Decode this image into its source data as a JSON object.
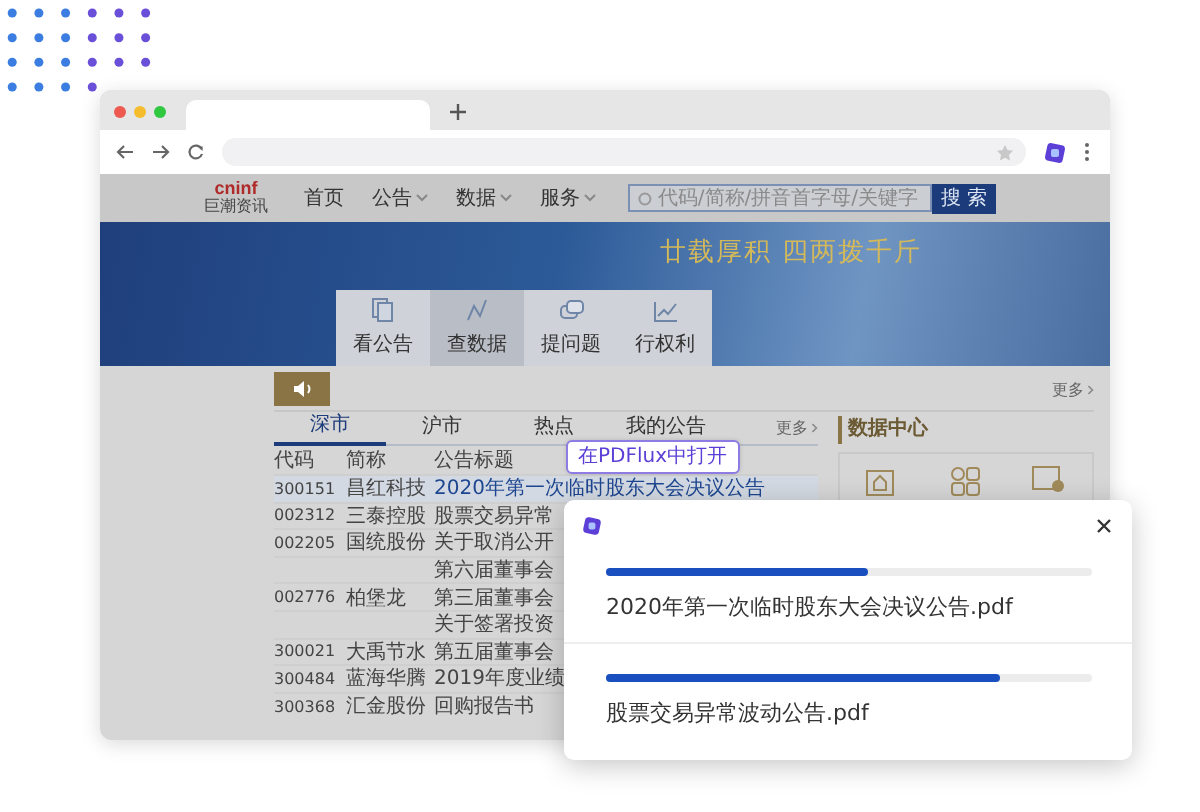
{
  "site_nav": {
    "logo": {
      "wordmark": "cninf",
      "subtitle": "巨潮资讯"
    },
    "items": [
      {
        "label": "首页",
        "has_menu": false
      },
      {
        "label": "公告",
        "has_menu": true
      },
      {
        "label": "数据",
        "has_menu": true
      },
      {
        "label": "服务",
        "has_menu": true
      }
    ],
    "search": {
      "placeholder": "代码/简称/拼音首字母/关键字",
      "button": "搜 索"
    }
  },
  "banner": {
    "slogan": "廿载厚积 四两拨千斤",
    "tiles": [
      {
        "label": "看公告",
        "selected": false
      },
      {
        "label": "查数据",
        "selected": true
      },
      {
        "label": "提问题",
        "selected": false
      },
      {
        "label": "行权利",
        "selected": false
      }
    ]
  },
  "top_more": "更多",
  "announcements": {
    "tabs": [
      {
        "label": "深市",
        "selected": true
      },
      {
        "label": "沪市",
        "selected": false
      },
      {
        "label": "热点",
        "selected": false
      },
      {
        "label": "我的公告",
        "selected": false
      }
    ],
    "more": "更多",
    "columns": [
      "代码",
      "简称",
      "公告标题"
    ],
    "rows": [
      {
        "code": "300151",
        "name": "昌红科技",
        "title": "2020年第一次临时股东大会决议公告",
        "highlighted": true
      },
      {
        "code": "002312",
        "name": "三泰控股",
        "title": "股票交易异常",
        "highlighted": false
      },
      {
        "code": "002205",
        "name": "国统股份",
        "title": "关于取消公开",
        "highlighted": false
      },
      {
        "title": "第六届董事会",
        "highlighted": false
      },
      {
        "code": "002776",
        "name": "柏堡龙",
        "title": "第三届董事会",
        "highlighted": false
      },
      {
        "title": "关于签署投资",
        "highlighted": false
      },
      {
        "code": "300021",
        "name": "大禹节水",
        "title": "第五届董事会",
        "highlighted": false
      },
      {
        "code": "300484",
        "name": "蓝海华腾",
        "title": "2019年度业绩",
        "highlighted": false
      },
      {
        "code": "300368",
        "name": "汇金股份",
        "title": "回购报告书",
        "highlighted": false
      }
    ]
  },
  "data_center": {
    "title": "数据中心"
  },
  "tooltip": "在PDFlux中打开",
  "popup": {
    "items": [
      {
        "filename": "2020年第一次临时股东大会决议公告.pdf",
        "level": 0.54
      },
      {
        "filename": "股票交易异常波动公告.pdf",
        "level": 0.81
      }
    ]
  }
}
